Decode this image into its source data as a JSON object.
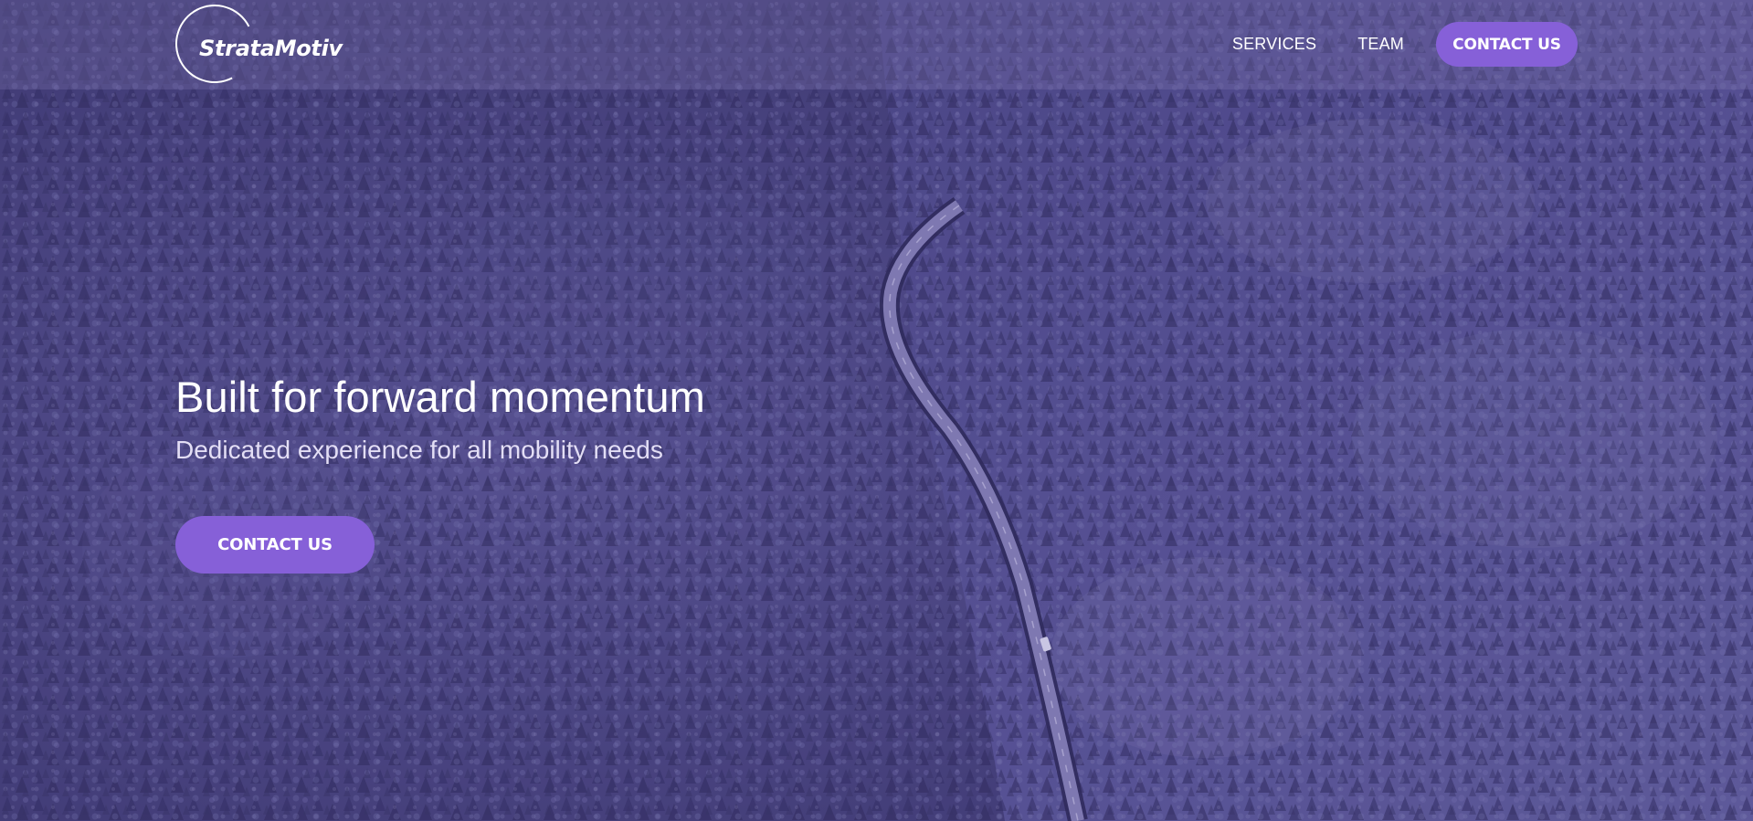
{
  "brand": {
    "name": "StrataMotiv"
  },
  "nav": {
    "links": [
      {
        "label": "SERVICES"
      },
      {
        "label": "TEAM"
      }
    ],
    "cta_label": "CONTACT US"
  },
  "hero": {
    "title": "Built for forward momentum",
    "subtitle": "Dedicated experience for all mobility needs",
    "cta_label": "CONTACT US",
    "background": "aerial-forest-road"
  },
  "colors": {
    "accent": "#8660d8",
    "overlay": "#3a3566",
    "text": "#ffffff"
  }
}
